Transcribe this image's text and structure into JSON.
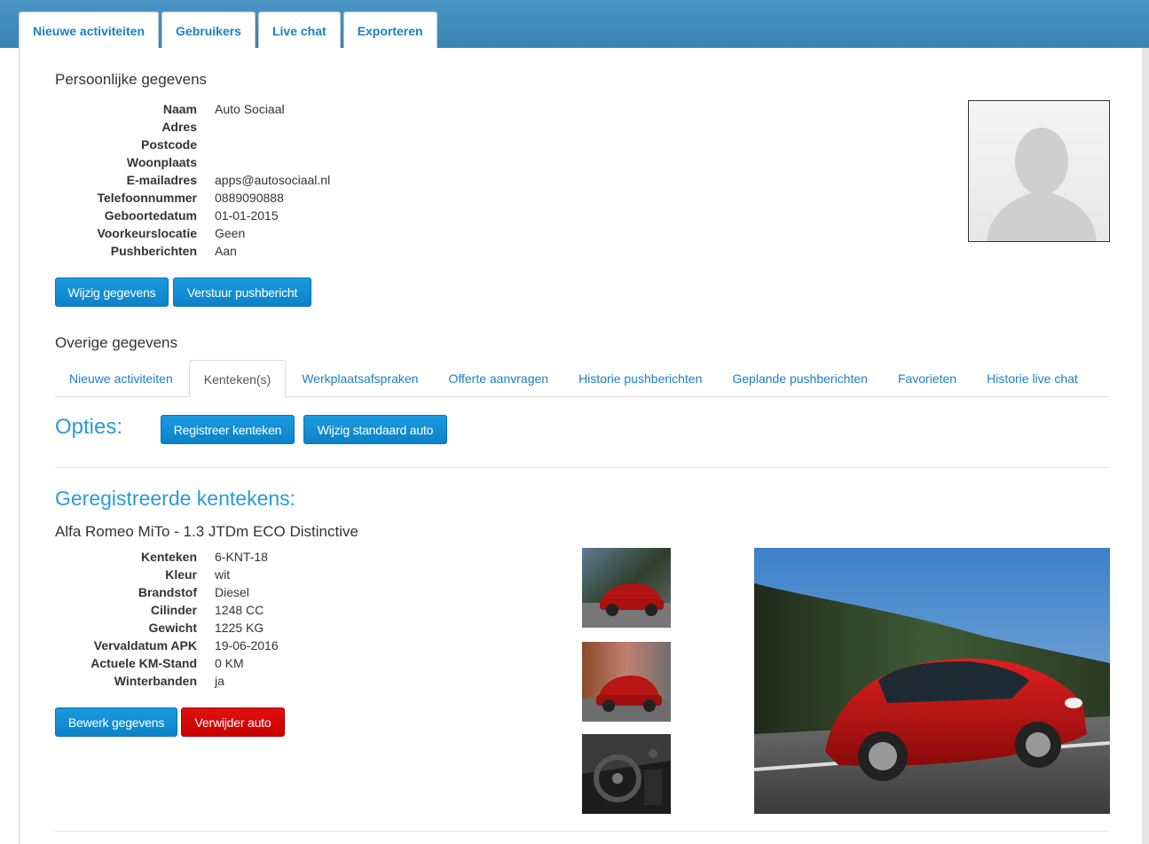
{
  "main_tabs": [
    {
      "label": "Nieuwe activiteiten"
    },
    {
      "label": "Gebruikers"
    },
    {
      "label": "Live chat"
    },
    {
      "label": "Exporteren"
    }
  ],
  "personal": {
    "title": "Persoonlijke gegevens",
    "fields": [
      {
        "label": "Naam",
        "value": "Auto Sociaal"
      },
      {
        "label": "Adres",
        "value": ""
      },
      {
        "label": "Postcode",
        "value": ""
      },
      {
        "label": "Woonplaats",
        "value": ""
      },
      {
        "label": "E-mailadres",
        "value": "apps@autosociaal.nl"
      },
      {
        "label": "Telefoonnummer",
        "value": "0889090888"
      },
      {
        "label": "Geboortedatum",
        "value": "01-01-2015"
      },
      {
        "label": "Voorkeurslocatie",
        "value": "Geen"
      },
      {
        "label": "Pushberichten",
        "value": "Aan"
      }
    ],
    "edit_button": "Wijzig gegevens",
    "push_button": "Verstuur pushbericht"
  },
  "other": {
    "title": "Overige gegevens",
    "tabs": [
      {
        "label": "Nieuwe activiteiten"
      },
      {
        "label": "Kenteken(s)"
      },
      {
        "label": "Werkplaatsafspraken"
      },
      {
        "label": "Offerte aanvragen"
      },
      {
        "label": "Historie pushberichten"
      },
      {
        "label": "Geplande pushberichten"
      },
      {
        "label": "Favorieten"
      },
      {
        "label": "Historie live chat"
      }
    ]
  },
  "options": {
    "title": "Opties:",
    "register_button": "Registreer kenteken",
    "default_car_button": "Wijzig standaard auto"
  },
  "registered": {
    "title": "Geregistreerde kentekens:",
    "car_title": "Alfa Romeo MiTo - 1.3 JTDm ECO Distinctive",
    "fields": [
      {
        "label": "Kenteken",
        "value": "6-KNT-18"
      },
      {
        "label": "Kleur",
        "value": "wit"
      },
      {
        "label": "Brandstof",
        "value": "Diesel"
      },
      {
        "label": "Cilinder",
        "value": "1248 CC"
      },
      {
        "label": "Gewicht",
        "value": "1225 KG"
      },
      {
        "label": "Vervaldatum APK",
        "value": "19-06-2016"
      },
      {
        "label": "Actuele KM-Stand",
        "value": "0 KM"
      },
      {
        "label": "Winterbanden",
        "value": "ja"
      }
    ],
    "edit_button": "Bewerk gegevens",
    "delete_button": "Verwijder auto"
  },
  "colors": {
    "accent": "#1a80c6",
    "heading_blue": "#2a9ad8",
    "danger": "#d00000",
    "topbar": "#4290c0"
  }
}
